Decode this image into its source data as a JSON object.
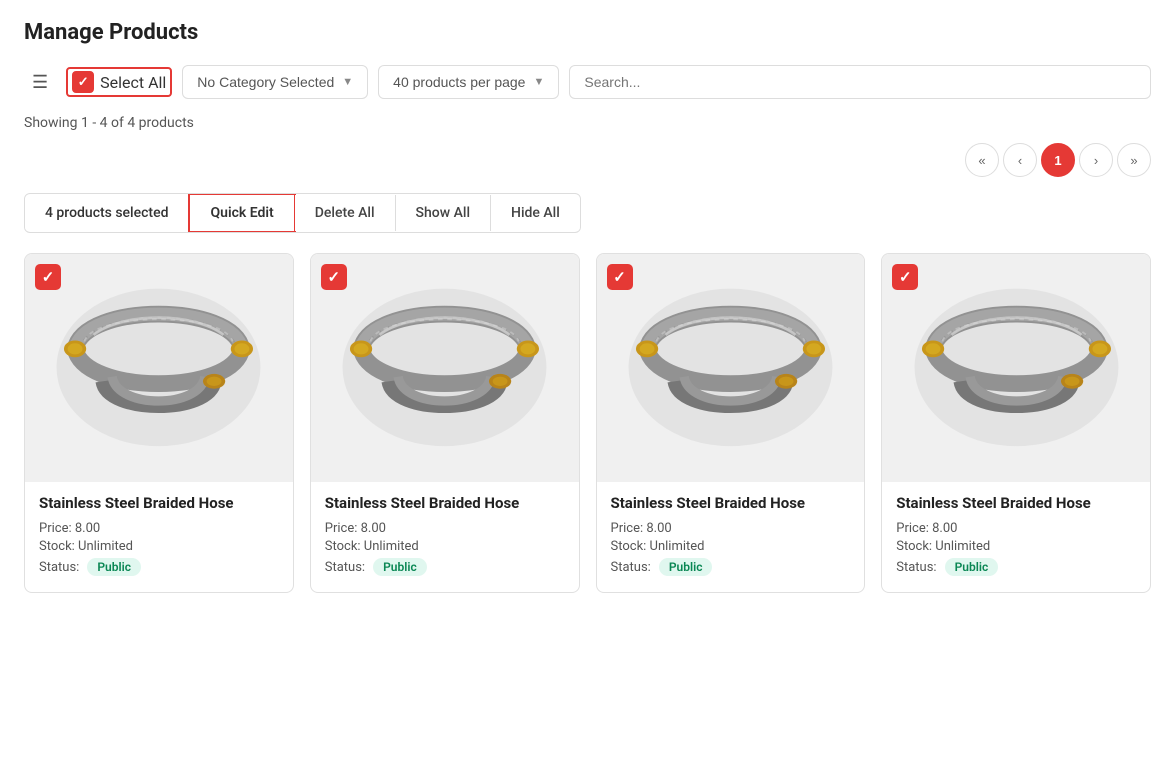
{
  "page": {
    "title": "Manage Products"
  },
  "toolbar": {
    "menu_icon": "☰",
    "select_all_label": "Select All",
    "category_placeholder": "No Category Selected",
    "per_page_label": "40 products per page",
    "search_placeholder": "Search..."
  },
  "showing": {
    "text": "Showing 1 - 4 of 4 products"
  },
  "pagination": {
    "first": "«",
    "prev": "‹",
    "current": "1",
    "next": "›",
    "last": "»"
  },
  "bulk_actions": {
    "selected_count": "4 products selected",
    "quick_edit": "Quick Edit",
    "delete_all": "Delete All",
    "show_all": "Show All",
    "hide_all": "Hide All"
  },
  "products": [
    {
      "name": "Stainless Steel Braided Hose",
      "price": "Price: 8.00",
      "stock": "Stock: Unlimited",
      "status_label": "Status:",
      "status": "Public",
      "checked": true
    },
    {
      "name": "Stainless Steel Braided Hose",
      "price": "Price: 8.00",
      "stock": "Stock: Unlimited",
      "status_label": "Status:",
      "status": "Public",
      "checked": true
    },
    {
      "name": "Stainless Steel Braided Hose",
      "price": "Price: 8.00",
      "stock": "Stock: Unlimited",
      "status_label": "Status:",
      "status": "Public",
      "checked": true
    },
    {
      "name": "Stainless Steel Braided Hose",
      "price": "Price: 8.00",
      "stock": "Stock: Unlimited",
      "status_label": "Status:",
      "status": "Public",
      "checked": true
    }
  ]
}
